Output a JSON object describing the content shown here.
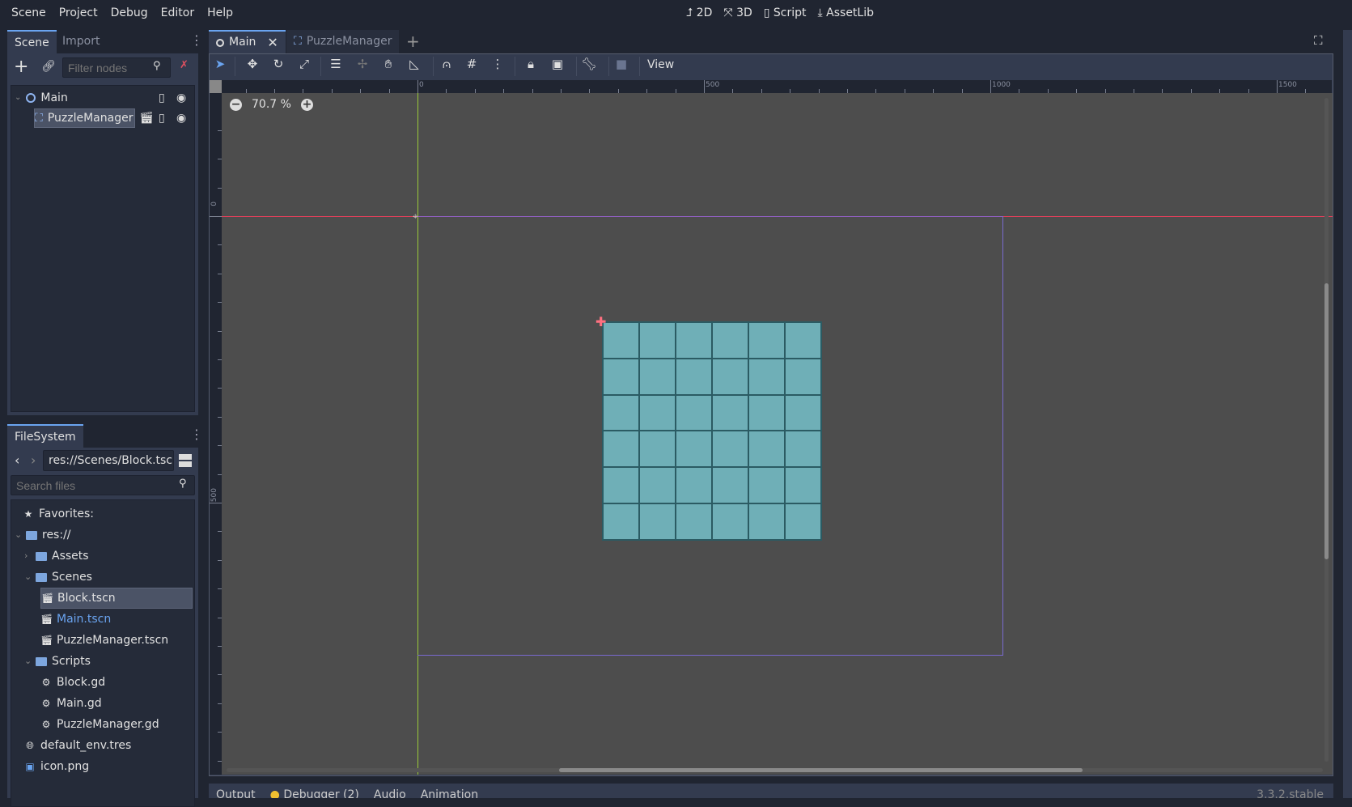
{
  "menu": [
    "Scene",
    "Project",
    "Debug",
    "Editor",
    "Help"
  ],
  "modes": [
    {
      "label": "2D",
      "icon": "2d-icon",
      "active": true
    },
    {
      "label": "3D",
      "icon": "3d-icon"
    },
    {
      "label": "Script",
      "icon": "script-icon"
    },
    {
      "label": "AssetLib",
      "icon": "assetlib-icon"
    }
  ],
  "scene_dock": {
    "tabs": [
      "Scene",
      "Import"
    ],
    "filter_placeholder": "Filter nodes",
    "nodes": [
      {
        "label": "Main",
        "icon": "node2d-icon"
      },
      {
        "label": "PuzzleManager",
        "icon": "control-icon",
        "selected": true
      }
    ]
  },
  "filesystem": {
    "tab": "FileSystem",
    "path": "res://Scenes/Block.tsc",
    "search_placeholder": "Search files",
    "items": [
      {
        "label": "Favorites:",
        "icon": "star-icon",
        "depth": 0
      },
      {
        "label": "res://",
        "icon": "folder-icon",
        "depth": 0,
        "expanded": true
      },
      {
        "label": "Assets",
        "icon": "folder-icon",
        "depth": 1,
        "collapsed": true
      },
      {
        "label": "Scenes",
        "icon": "folder-icon",
        "depth": 1,
        "expanded": true
      },
      {
        "label": "Block.tscn",
        "icon": "scene-icon",
        "depth": 2,
        "selected": true
      },
      {
        "label": "Main.tscn",
        "icon": "scene-icon",
        "depth": 2,
        "highlight": true
      },
      {
        "label": "PuzzleManager.tscn",
        "icon": "scene-icon",
        "depth": 2
      },
      {
        "label": "Scripts",
        "icon": "folder-icon",
        "depth": 1,
        "expanded": true
      },
      {
        "label": "Block.gd",
        "icon": "gear-icon",
        "depth": 2
      },
      {
        "label": "Main.gd",
        "icon": "gear-icon",
        "depth": 2
      },
      {
        "label": "PuzzleManager.gd",
        "icon": "gear-icon",
        "depth": 2
      },
      {
        "label": "default_env.tres",
        "icon": "globe-icon",
        "depth": 1
      },
      {
        "label": "icon.png",
        "icon": "image-icon",
        "depth": 1
      }
    ]
  },
  "editor_tabs": [
    {
      "label": "Main",
      "active": true
    },
    {
      "label": "PuzzleManager"
    }
  ],
  "toolbar": {
    "view_label": "View"
  },
  "viewport": {
    "zoom": "70.7 %",
    "ruler_labels_x": [
      "0",
      "500",
      "1000",
      "1500"
    ],
    "ruler_labels_y": [
      "0",
      "500"
    ],
    "grid": {
      "rows": 6,
      "cols": 6,
      "fill": "#6fafb7",
      "line": "#2b5b63"
    }
  },
  "bottom": {
    "tabs": [
      "Output",
      "Debugger (2)",
      "Audio",
      "Animation"
    ],
    "version": "3.3.2.stable"
  },
  "colors": {
    "accent": "#6aa4f0",
    "x_axis": "#e0405a",
    "y_axis": "#9ac93a",
    "viewport_bg": "#4d4d4d"
  }
}
